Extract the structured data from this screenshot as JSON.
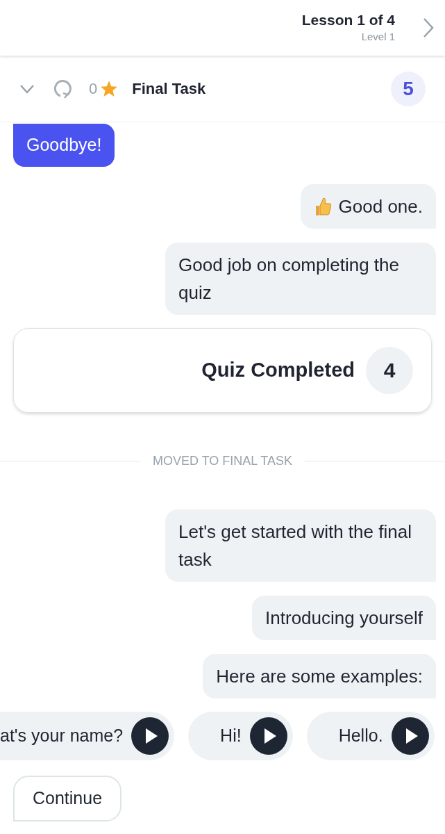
{
  "header": {
    "title": "Lesson 1 of 4",
    "subtitle": "Level 1"
  },
  "task_bar": {
    "stars": "0",
    "title": "Final Task",
    "count": "5"
  },
  "messages": [
    {
      "kind": "sent",
      "text": "Goodbye!"
    },
    {
      "kind": "received",
      "text": "Good one.",
      "thumbs_up": true
    },
    {
      "kind": "received",
      "text": "Good job on completing the quiz"
    },
    {
      "kind": "card",
      "text": "Quiz Completed",
      "count": "4"
    },
    {
      "kind": "divider",
      "text": "MOVED TO FINAL TASK"
    },
    {
      "kind": "received",
      "text": "Let's get started with the final task"
    },
    {
      "kind": "received",
      "text": "Introducing yourself"
    },
    {
      "kind": "received",
      "text": "Here are some examples:"
    }
  ],
  "examples": [
    "at's your name?",
    "Hi!",
    "Hello."
  ],
  "continue_button": "Continue"
}
